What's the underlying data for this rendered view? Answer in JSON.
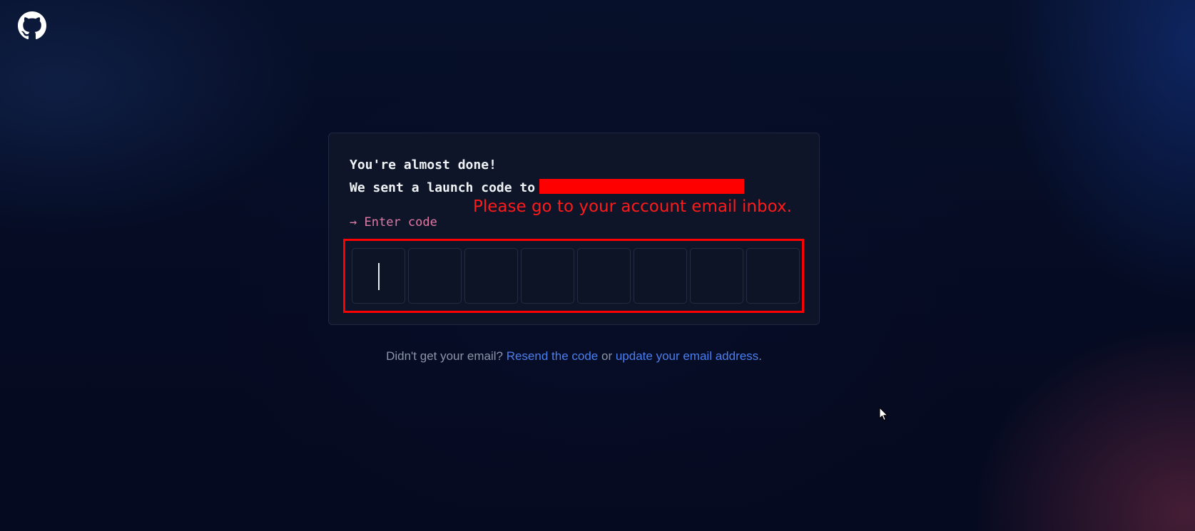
{
  "logo": {
    "icon": "github-octocat-icon"
  },
  "card": {
    "line1": "You're almost done!",
    "line2": "We sent a launch code to",
    "enter_code_arrow": "→",
    "enter_code_label": "Enter code",
    "code_cells": [
      "",
      "",
      "",
      "",
      "",
      "",
      "",
      ""
    ],
    "annotation": "Please go to your account email inbox."
  },
  "footer": {
    "prefix": "Didn't get your email?",
    "resend_link": "Resend the code",
    "or": "or",
    "update_link": "update your email address",
    "suffix": "."
  },
  "colors": {
    "background": "#060c24",
    "card_bg": "#0e1529",
    "link": "#4a7ff0",
    "enter_code": "#e07aa4",
    "annotation_red": "#ff0000"
  }
}
